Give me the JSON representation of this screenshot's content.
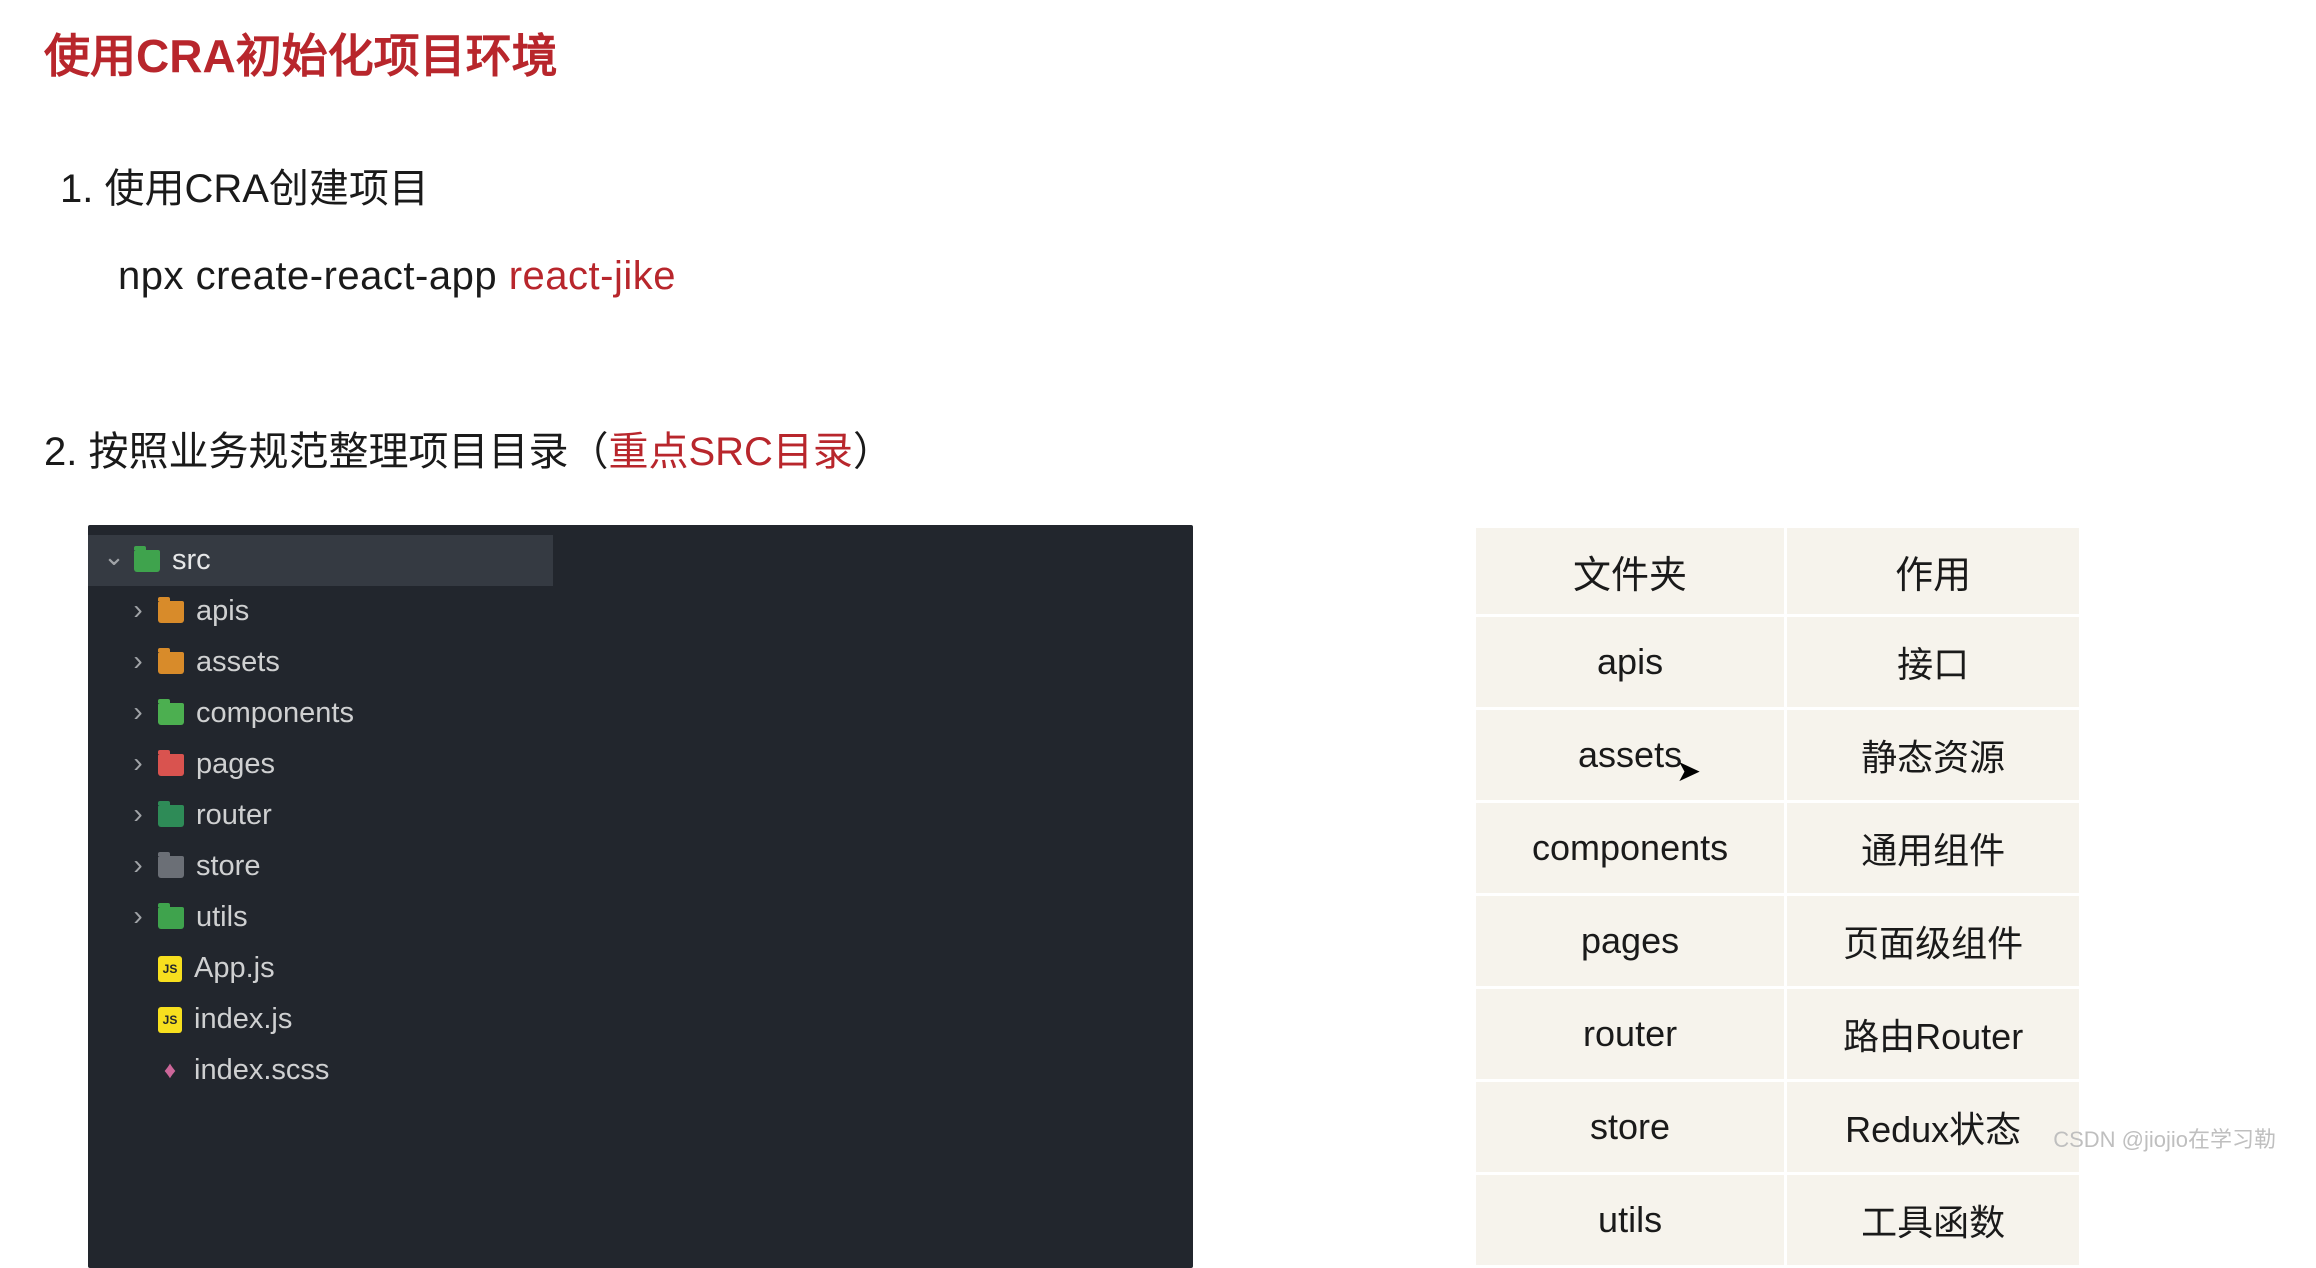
{
  "title": "使用CRA初始化项目环境",
  "step1": {
    "label": "1. 使用CRA创建项目",
    "command_prefix": "npx  create-react-app  ",
    "command_arg": "react-jike"
  },
  "step2": {
    "prefix": "2. 按照业务规范整理项目目录（",
    "highlight": "重点SRC目录",
    "suffix": "）"
  },
  "tree": {
    "root": "src",
    "items": [
      {
        "label": "apis",
        "icon": "orange"
      },
      {
        "label": "assets",
        "icon": "orange"
      },
      {
        "label": "components",
        "icon": "green2"
      },
      {
        "label": "pages",
        "icon": "red"
      },
      {
        "label": "router",
        "icon": "green3"
      },
      {
        "label": "store",
        "icon": "gray"
      },
      {
        "label": "utils",
        "icon": "green4"
      }
    ],
    "files": [
      {
        "label": "App.js",
        "type": "js",
        "badge": "JS"
      },
      {
        "label": "index.js",
        "type": "js",
        "badge": "JS"
      },
      {
        "label": "index.scss",
        "type": "scss",
        "badge": "♦"
      }
    ]
  },
  "table": {
    "headers": [
      "文件夹",
      "作用"
    ],
    "rows": [
      [
        "apis",
        "接口"
      ],
      [
        "assets",
        "静态资源"
      ],
      [
        "components",
        "通用组件"
      ],
      [
        "pages",
        "页面级组件"
      ],
      [
        "router",
        "路由Router"
      ],
      [
        "store",
        "Redux状态"
      ],
      [
        "utils",
        "工具函数"
      ]
    ]
  },
  "watermark": "CSDN @jiojio在学习勒"
}
